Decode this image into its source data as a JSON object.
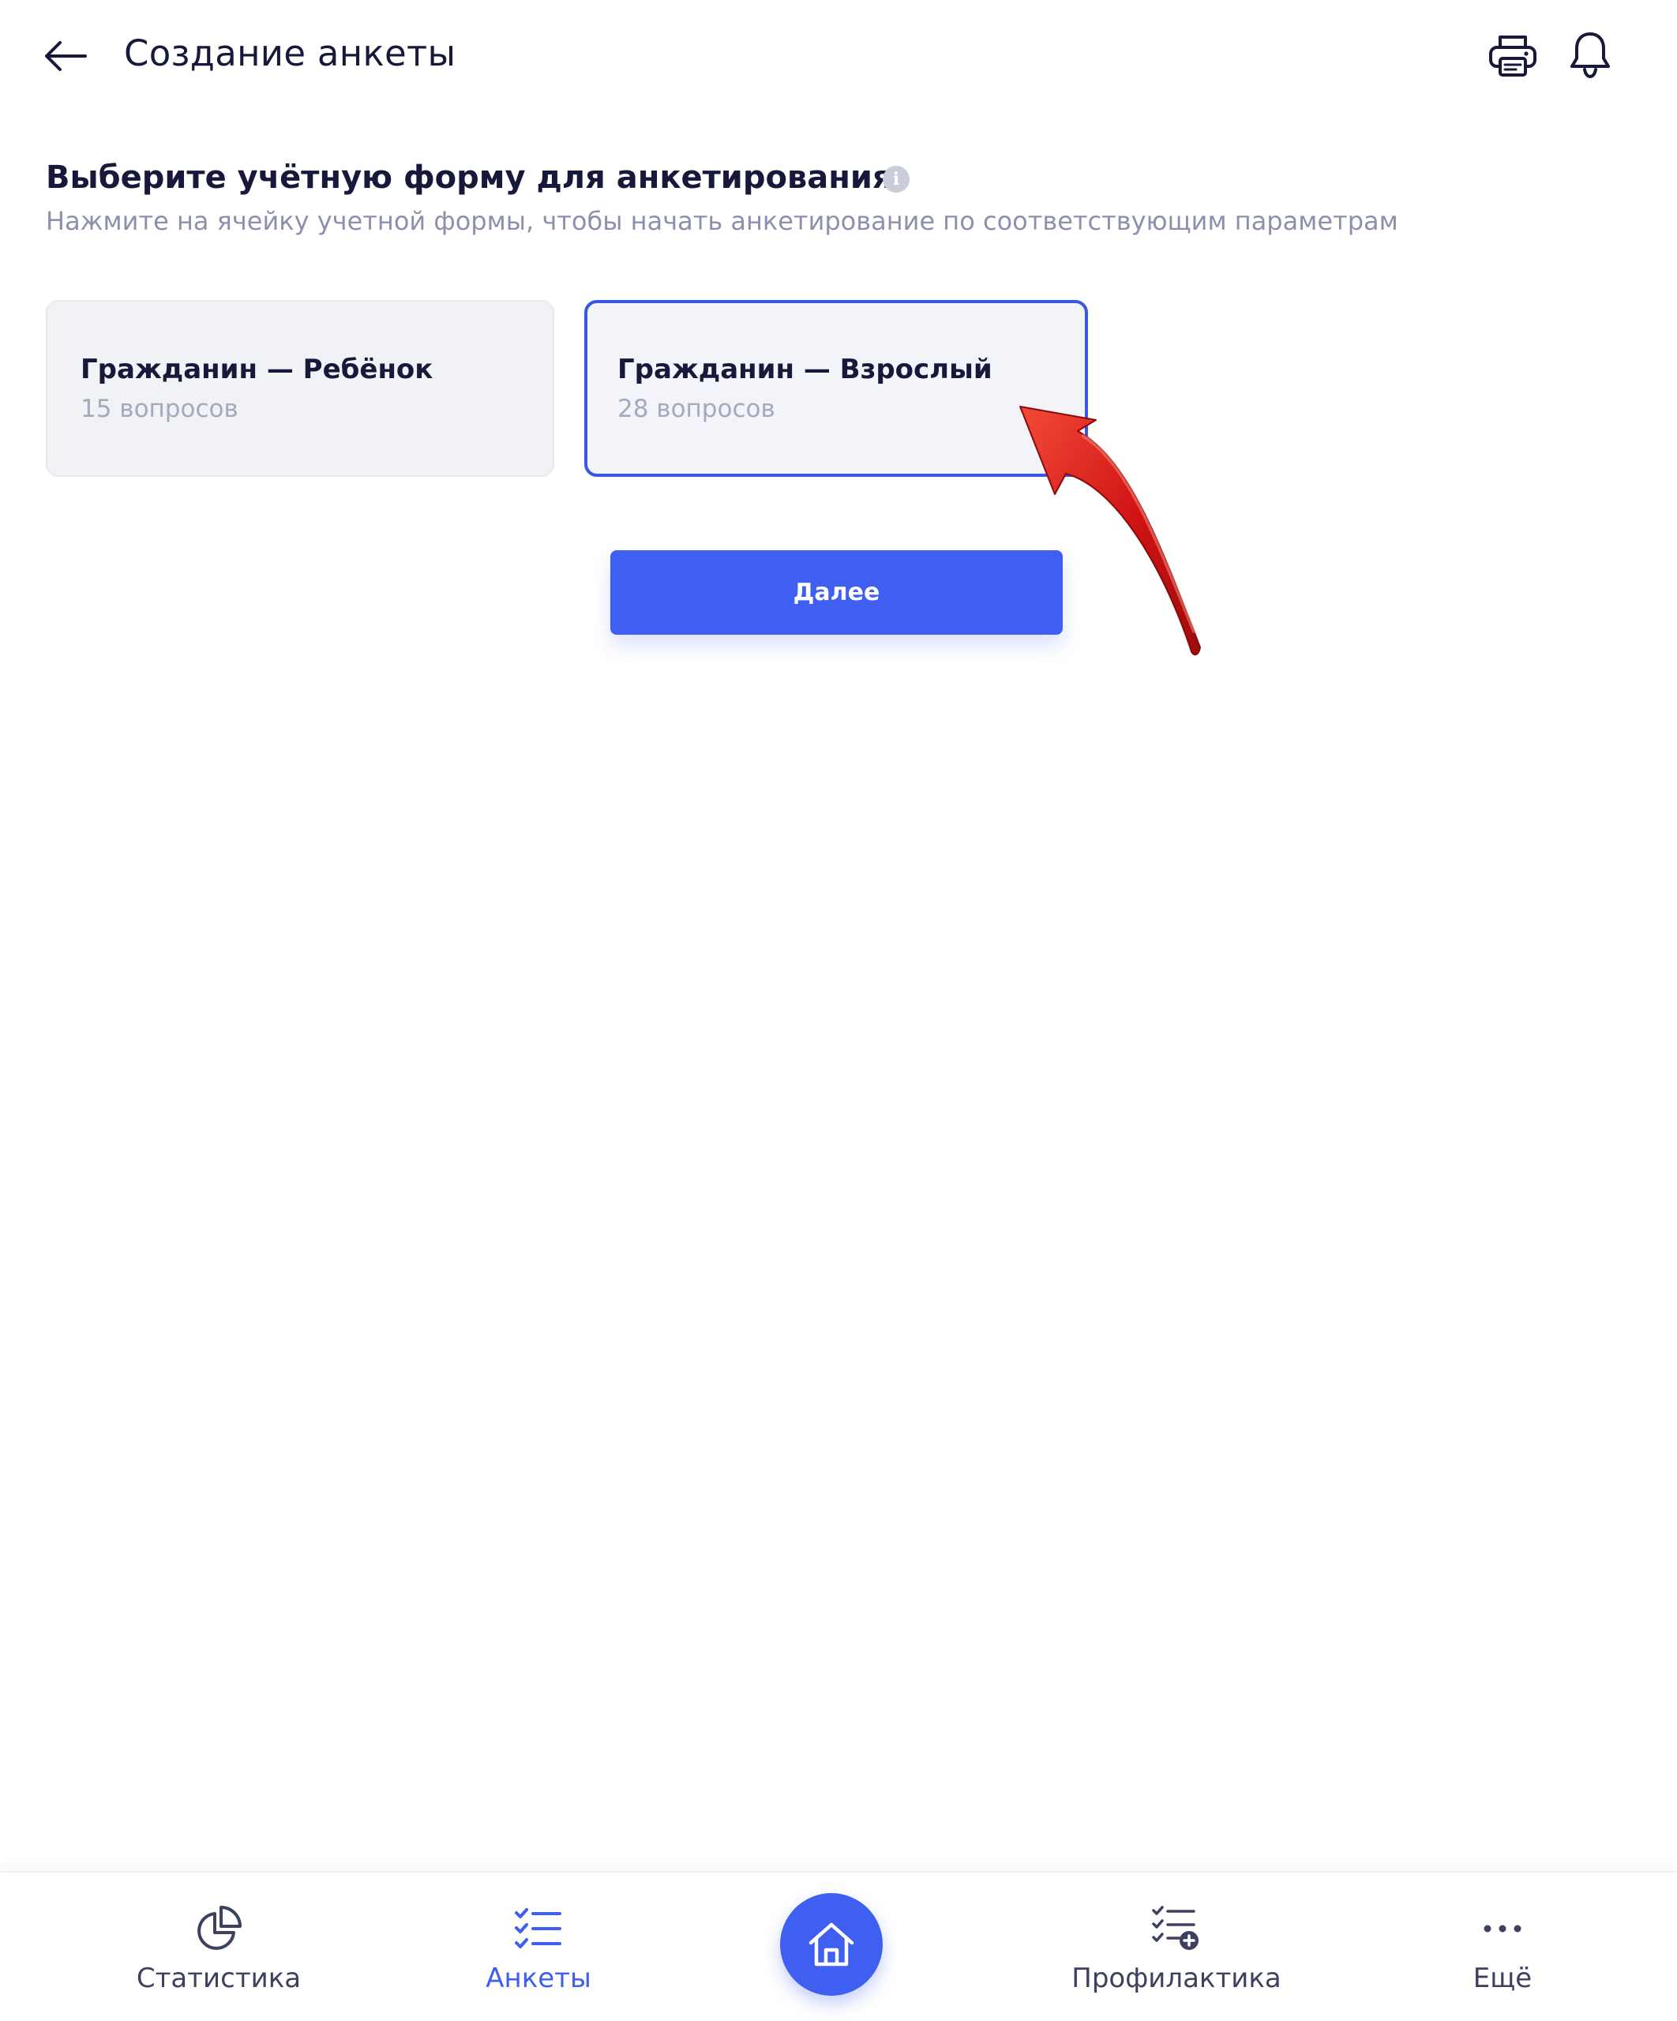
{
  "header": {
    "title": "Создание анкеты",
    "back_icon": "arrow-left-icon",
    "print_icon": "printer-icon",
    "notifications_icon": "bell-icon"
  },
  "section": {
    "title": "Выберите учётную форму для анкетирования",
    "info_icon": "info-icon",
    "subtitle": "Нажмите на ячейку учетной формы, чтобы начать анкетирование по соответствующим параметрам"
  },
  "forms": [
    {
      "title": "Гражданин — Ребёнок",
      "count": "15 вопросов",
      "selected": false
    },
    {
      "title": "Гражданин — Взрослый",
      "count": "28 вопросов",
      "selected": true
    }
  ],
  "next_button": {
    "label": "Далее"
  },
  "bottom_nav": {
    "items": [
      {
        "label": "Статистика",
        "icon": "pie-chart-icon",
        "active": false
      },
      {
        "label": "Анкеты",
        "icon": "checklist-icon",
        "active": true
      },
      {
        "label": "",
        "icon": "home-icon",
        "active": false
      },
      {
        "label": "Профилактика",
        "icon": "checklist-add-icon",
        "active": false
      },
      {
        "label": "Ещё",
        "icon": "more-dots-icon",
        "active": false
      }
    ]
  },
  "colors": {
    "accent": "#3e5ff0",
    "selected_border": "#3957e3",
    "title_text": "#16193a",
    "subtitle_text": "#8d90ad",
    "card_bg": "#f0f2f6",
    "annotation_arrow": "#d21414"
  }
}
